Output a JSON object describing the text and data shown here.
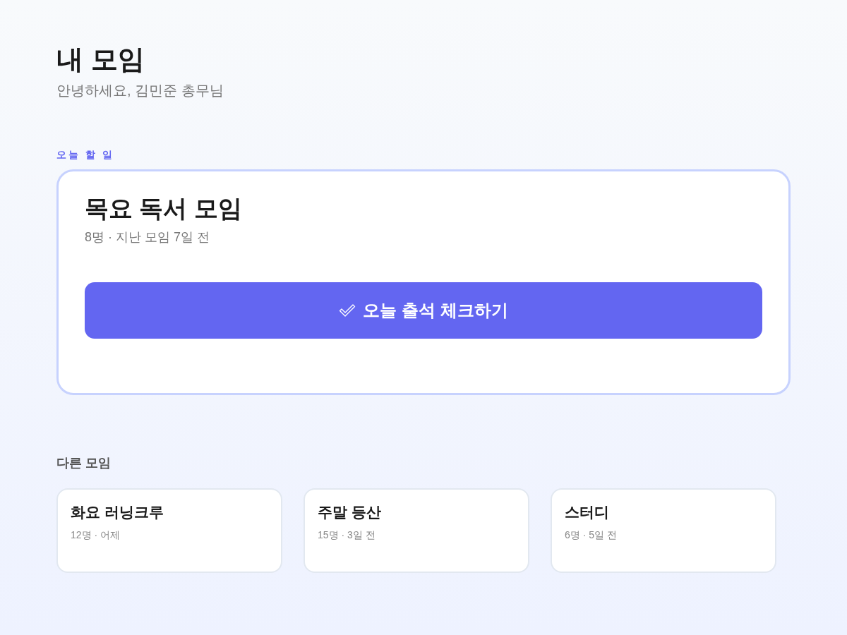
{
  "header": {
    "title": "내 모임",
    "greeting": "안녕하세요, 김민준 총무님"
  },
  "today": {
    "label": "오늘 할 일",
    "group": {
      "name": "목요 독서 모임",
      "meta": "8명 · 지난 모임 7일 전"
    },
    "action": {
      "label": "오늘 출석 체크하기"
    }
  },
  "others": {
    "heading": "다른 모임",
    "groups": [
      {
        "name": "화요 러닝크루",
        "meta": "12명 · 어제"
      },
      {
        "name": "주말 등산",
        "meta": "15명 · 3일 전"
      },
      {
        "name": "스터디",
        "meta": "6명 · 5일 전"
      }
    ]
  }
}
